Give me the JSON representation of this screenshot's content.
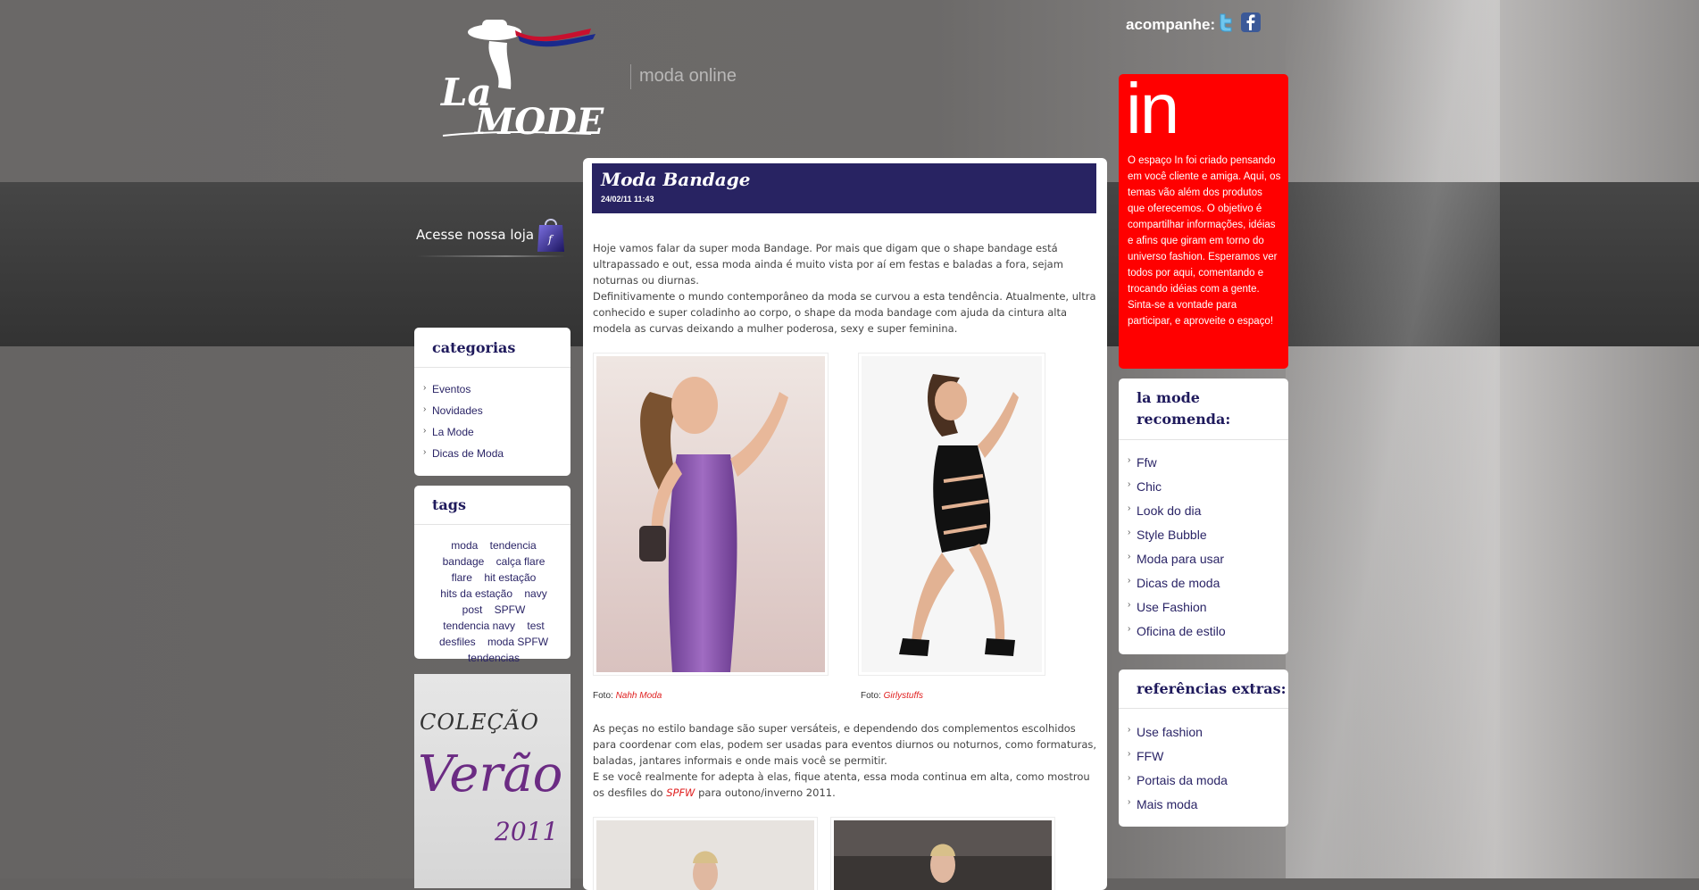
{
  "header": {
    "logo_alt": "La Mode",
    "tagline": "moda online",
    "follow_label": "acompanhe:",
    "store_link": "Acesse nossa loja"
  },
  "categories": {
    "title": "categorias",
    "items": [
      "Eventos",
      "Novidades",
      "La Mode",
      "Dicas de Moda"
    ]
  },
  "tags": {
    "title": "tags",
    "items": [
      "moda",
      "tendencia",
      "bandage",
      "calça flare",
      "flare",
      "hit estação",
      "hits da estação",
      "navy",
      "post",
      "SPFW",
      "tendencia navy",
      "test",
      "desfiles",
      "moda SPFW",
      "tendencias"
    ]
  },
  "promo": {
    "line1": "COLEÇÃO",
    "line2": "Verão",
    "line3": "2011"
  },
  "post": {
    "title": "Moda Bandage",
    "date": "24/02/11 11:43",
    "para1_a": "Hoje vamos falar da super moda Bandage. Por mais que digam que o shape bandage está ultrapassado e out, essa moda ainda é muito vista por aí em festas e baladas a fora, sejam noturnas ou diurnas.",
    "para1_b": "Definitivamente o mundo contemporâneo da moda se curvou a esta tendência. Atualmente, ultra conhecido e super coladinho ao corpo, o shape da moda bandage com ajuda da cintura alta modela as curvas deixando a mulher poderosa, sexy e super feminina.",
    "credit1_label": "Foto:",
    "credit1_src": "Nahh Moda",
    "credit2_label": "Foto:",
    "credit2_src": "Girlystuffs",
    "para2_a": "As peças no estilo bandage são super versáteis, e dependendo dos complementos escolhidos para coordenar com elas, podem ser usadas para eventos diurnos ou noturnos, como formaturas, baladas, jantares informais e onde mais você se permitir.",
    "para2_b_start": "E se você realmente for adepta à elas, fique atenta, essa moda continua em alta, como mostrou os desfiles do ",
    "para2_b_link": "SPFW",
    "para2_b_end": " para outono/inverno 2011."
  },
  "in_box": {
    "word": "in",
    "text": "O espaço In foi criado pensando em você cliente e amiga. Aqui, os temas vão além dos produtos que oferecemos. O objetivo é compartilhar informações, idéias e afins que giram em torno do universo fashion. Esperamos ver todos por aqui, comentando e trocando idéias com a gente. Sinta-se a vontade para participar, e aproveite o espaço!"
  },
  "recommends": {
    "title_l1": "la mode",
    "title_l2": "recomenda:",
    "items": [
      "Ffw",
      "Chic",
      "Look do dia",
      "Style Bubble",
      "Moda para usar",
      "Dicas de moda",
      "Use Fashion",
      "Oficina de estilo"
    ]
  },
  "refs": {
    "title": "referências extras:",
    "items": [
      "Use fashion",
      "FFW",
      "Portais da moda",
      "Mais moda"
    ]
  },
  "colors": {
    "post_header": "#282362",
    "link_text": "#2a2466",
    "accent_red": "#ff0000"
  }
}
